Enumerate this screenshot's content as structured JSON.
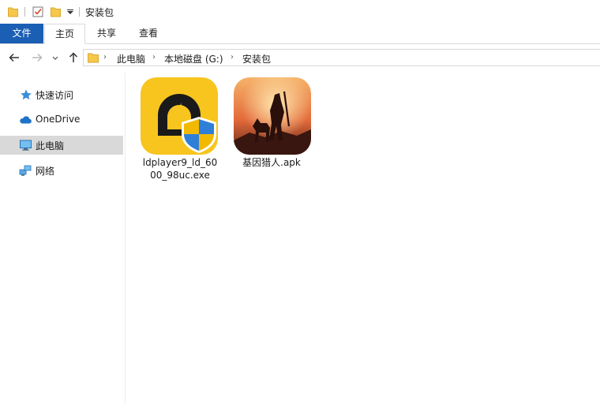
{
  "window": {
    "title": "安装包"
  },
  "ribbon": {
    "tabs": [
      {
        "label": "文件"
      },
      {
        "label": "主页"
      },
      {
        "label": "共享"
      },
      {
        "label": "查看"
      }
    ]
  },
  "address": {
    "crumbs": [
      "此电脑",
      "本地磁盘 (G:)",
      "安装包"
    ]
  },
  "nav": {
    "items": [
      {
        "label": "快速访问"
      },
      {
        "label": "OneDrive"
      },
      {
        "label": "此电脑"
      },
      {
        "label": "网络"
      }
    ]
  },
  "files": [
    {
      "name_line1": "ldplayer9_ld_60",
      "name_line2": "00_98uc.exe"
    },
    {
      "name_line1": "基因猎人.apk",
      "name_line2": ""
    }
  ],
  "colors": {
    "file_tab": "#1a5fb4",
    "selected_nav": "#d9d9d9",
    "folder_yellow": "#f5c84c",
    "ld_yellow": "#f7c51e"
  }
}
